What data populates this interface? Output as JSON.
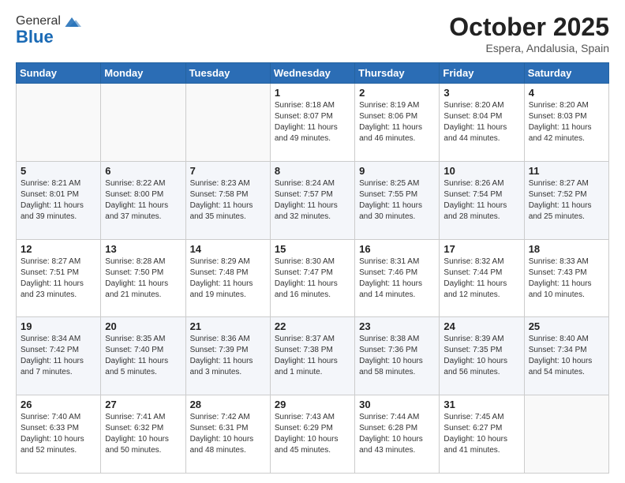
{
  "header": {
    "logo_general": "General",
    "logo_blue": "Blue",
    "month_title": "October 2025",
    "subtitle": "Espera, Andalusia, Spain"
  },
  "weekdays": [
    "Sunday",
    "Monday",
    "Tuesday",
    "Wednesday",
    "Thursday",
    "Friday",
    "Saturday"
  ],
  "weeks": [
    [
      {
        "day": "",
        "sunrise": "",
        "sunset": "",
        "daylight": ""
      },
      {
        "day": "",
        "sunrise": "",
        "sunset": "",
        "daylight": ""
      },
      {
        "day": "",
        "sunrise": "",
        "sunset": "",
        "daylight": ""
      },
      {
        "day": "1",
        "sunrise": "Sunrise: 8:18 AM",
        "sunset": "Sunset: 8:07 PM",
        "daylight": "Daylight: 11 hours and 49 minutes."
      },
      {
        "day": "2",
        "sunrise": "Sunrise: 8:19 AM",
        "sunset": "Sunset: 8:06 PM",
        "daylight": "Daylight: 11 hours and 46 minutes."
      },
      {
        "day": "3",
        "sunrise": "Sunrise: 8:20 AM",
        "sunset": "Sunset: 8:04 PM",
        "daylight": "Daylight: 11 hours and 44 minutes."
      },
      {
        "day": "4",
        "sunrise": "Sunrise: 8:20 AM",
        "sunset": "Sunset: 8:03 PM",
        "daylight": "Daylight: 11 hours and 42 minutes."
      }
    ],
    [
      {
        "day": "5",
        "sunrise": "Sunrise: 8:21 AM",
        "sunset": "Sunset: 8:01 PM",
        "daylight": "Daylight: 11 hours and 39 minutes."
      },
      {
        "day": "6",
        "sunrise": "Sunrise: 8:22 AM",
        "sunset": "Sunset: 8:00 PM",
        "daylight": "Daylight: 11 hours and 37 minutes."
      },
      {
        "day": "7",
        "sunrise": "Sunrise: 8:23 AM",
        "sunset": "Sunset: 7:58 PM",
        "daylight": "Daylight: 11 hours and 35 minutes."
      },
      {
        "day": "8",
        "sunrise": "Sunrise: 8:24 AM",
        "sunset": "Sunset: 7:57 PM",
        "daylight": "Daylight: 11 hours and 32 minutes."
      },
      {
        "day": "9",
        "sunrise": "Sunrise: 8:25 AM",
        "sunset": "Sunset: 7:55 PM",
        "daylight": "Daylight: 11 hours and 30 minutes."
      },
      {
        "day": "10",
        "sunrise": "Sunrise: 8:26 AM",
        "sunset": "Sunset: 7:54 PM",
        "daylight": "Daylight: 11 hours and 28 minutes."
      },
      {
        "day": "11",
        "sunrise": "Sunrise: 8:27 AM",
        "sunset": "Sunset: 7:52 PM",
        "daylight": "Daylight: 11 hours and 25 minutes."
      }
    ],
    [
      {
        "day": "12",
        "sunrise": "Sunrise: 8:27 AM",
        "sunset": "Sunset: 7:51 PM",
        "daylight": "Daylight: 11 hours and 23 minutes."
      },
      {
        "day": "13",
        "sunrise": "Sunrise: 8:28 AM",
        "sunset": "Sunset: 7:50 PM",
        "daylight": "Daylight: 11 hours and 21 minutes."
      },
      {
        "day": "14",
        "sunrise": "Sunrise: 8:29 AM",
        "sunset": "Sunset: 7:48 PM",
        "daylight": "Daylight: 11 hours and 19 minutes."
      },
      {
        "day": "15",
        "sunrise": "Sunrise: 8:30 AM",
        "sunset": "Sunset: 7:47 PM",
        "daylight": "Daylight: 11 hours and 16 minutes."
      },
      {
        "day": "16",
        "sunrise": "Sunrise: 8:31 AM",
        "sunset": "Sunset: 7:46 PM",
        "daylight": "Daylight: 11 hours and 14 minutes."
      },
      {
        "day": "17",
        "sunrise": "Sunrise: 8:32 AM",
        "sunset": "Sunset: 7:44 PM",
        "daylight": "Daylight: 11 hours and 12 minutes."
      },
      {
        "day": "18",
        "sunrise": "Sunrise: 8:33 AM",
        "sunset": "Sunset: 7:43 PM",
        "daylight": "Daylight: 11 hours and 10 minutes."
      }
    ],
    [
      {
        "day": "19",
        "sunrise": "Sunrise: 8:34 AM",
        "sunset": "Sunset: 7:42 PM",
        "daylight": "Daylight: 11 hours and 7 minutes."
      },
      {
        "day": "20",
        "sunrise": "Sunrise: 8:35 AM",
        "sunset": "Sunset: 7:40 PM",
        "daylight": "Daylight: 11 hours and 5 minutes."
      },
      {
        "day": "21",
        "sunrise": "Sunrise: 8:36 AM",
        "sunset": "Sunset: 7:39 PM",
        "daylight": "Daylight: 11 hours and 3 minutes."
      },
      {
        "day": "22",
        "sunrise": "Sunrise: 8:37 AM",
        "sunset": "Sunset: 7:38 PM",
        "daylight": "Daylight: 11 hours and 1 minute."
      },
      {
        "day": "23",
        "sunrise": "Sunrise: 8:38 AM",
        "sunset": "Sunset: 7:36 PM",
        "daylight": "Daylight: 10 hours and 58 minutes."
      },
      {
        "day": "24",
        "sunrise": "Sunrise: 8:39 AM",
        "sunset": "Sunset: 7:35 PM",
        "daylight": "Daylight: 10 hours and 56 minutes."
      },
      {
        "day": "25",
        "sunrise": "Sunrise: 8:40 AM",
        "sunset": "Sunset: 7:34 PM",
        "daylight": "Daylight: 10 hours and 54 minutes."
      }
    ],
    [
      {
        "day": "26",
        "sunrise": "Sunrise: 7:40 AM",
        "sunset": "Sunset: 6:33 PM",
        "daylight": "Daylight: 10 hours and 52 minutes."
      },
      {
        "day": "27",
        "sunrise": "Sunrise: 7:41 AM",
        "sunset": "Sunset: 6:32 PM",
        "daylight": "Daylight: 10 hours and 50 minutes."
      },
      {
        "day": "28",
        "sunrise": "Sunrise: 7:42 AM",
        "sunset": "Sunset: 6:31 PM",
        "daylight": "Daylight: 10 hours and 48 minutes."
      },
      {
        "day": "29",
        "sunrise": "Sunrise: 7:43 AM",
        "sunset": "Sunset: 6:29 PM",
        "daylight": "Daylight: 10 hours and 45 minutes."
      },
      {
        "day": "30",
        "sunrise": "Sunrise: 7:44 AM",
        "sunset": "Sunset: 6:28 PM",
        "daylight": "Daylight: 10 hours and 43 minutes."
      },
      {
        "day": "31",
        "sunrise": "Sunrise: 7:45 AM",
        "sunset": "Sunset: 6:27 PM",
        "daylight": "Daylight: 10 hours and 41 minutes."
      },
      {
        "day": "",
        "sunrise": "",
        "sunset": "",
        "daylight": ""
      }
    ]
  ]
}
